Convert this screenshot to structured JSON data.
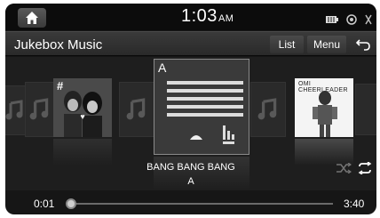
{
  "status_bar": {
    "clock_time": "1:03",
    "clock_ampm": "AM",
    "icons": [
      "home-icon",
      "battery-icon",
      "signal-icon",
      "wireless-icon"
    ]
  },
  "header": {
    "title": "Jukebox Music",
    "list_label": "List",
    "menu_label": "Menu",
    "back_icon": "back-arrow-icon"
  },
  "coverflow": {
    "album_left_badge": "#",
    "center_letter": "A",
    "album_right_label": "OMI CHEERLEADER"
  },
  "now_playing": {
    "title": "BANG BANG BANG",
    "artist": "A"
  },
  "playback": {
    "elapsed": "0:01",
    "total": "3:40",
    "progress_fraction": 0.005
  },
  "colors": {
    "screen_bg": "#161616",
    "title_bar": "#323232",
    "text": "#ffffff"
  }
}
